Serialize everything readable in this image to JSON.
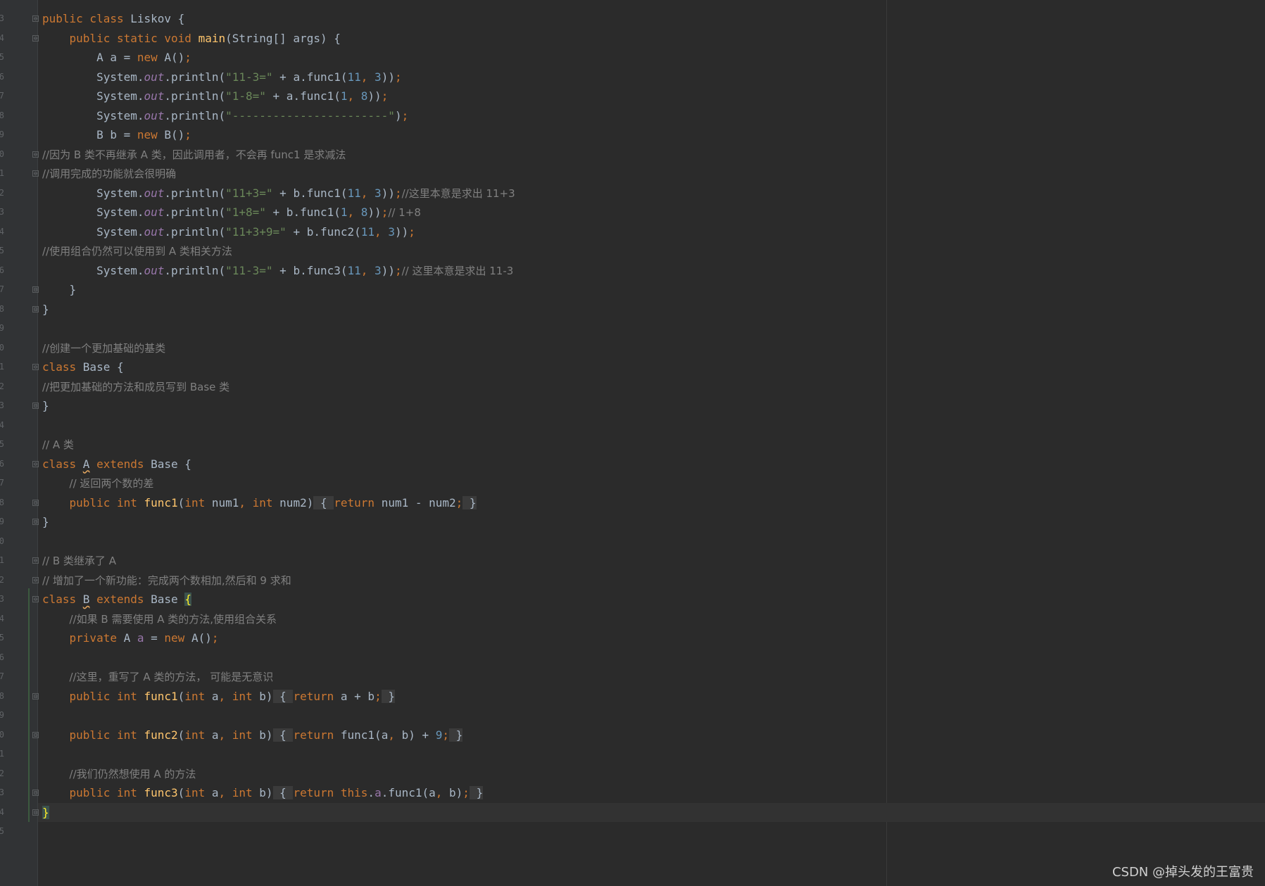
{
  "editor": {
    "line_numbers": [
      "3",
      "4",
      "5",
      "6",
      "7",
      "8",
      "9",
      "0",
      "1",
      "2",
      "3",
      "4",
      "5",
      "6",
      "7",
      "8",
      "9",
      "0",
      "1",
      "2",
      "3",
      "4",
      "5",
      "6",
      "7",
      "8",
      "9",
      "0",
      "1",
      "2",
      "3",
      "4",
      "5",
      "6",
      "7",
      "8",
      "9",
      "0",
      "1",
      "2",
      "3",
      "4",
      "5"
    ],
    "fold_markers": [
      "⊖",
      "⊖",
      "⊖",
      "⊖",
      "⊟",
      "⊟",
      "⊖",
      "⊟",
      "⊖",
      "⊟",
      "⊟",
      "⊖",
      "⊖",
      "⊖",
      "⊟",
      "⊟",
      "⊟",
      "⊟"
    ],
    "lines": [
      [
        [
          "kw",
          "public class "
        ],
        [
          "p",
          "Liskov {"
        ]
      ],
      [
        [
          "p",
          "    "
        ],
        [
          "kw",
          "public static void "
        ],
        [
          "fn",
          "main"
        ],
        [
          "p",
          "(String[] args) {"
        ]
      ],
      [
        [
          "p",
          "        A a = "
        ],
        [
          "kw",
          "new "
        ],
        [
          "p",
          "A()"
        ],
        [
          "kw",
          ";"
        ]
      ],
      [
        [
          "p",
          "        System."
        ],
        [
          "st",
          "out"
        ],
        [
          "p",
          ".println("
        ],
        [
          "str",
          "\"11-3=\""
        ],
        [
          "p",
          " + a.func1("
        ],
        [
          "num",
          "11"
        ],
        [
          "kw",
          ", "
        ],
        [
          "num",
          "3"
        ],
        [
          "p",
          "))"
        ],
        [
          "kw",
          ";"
        ]
      ],
      [
        [
          "p",
          "        System."
        ],
        [
          "st",
          "out"
        ],
        [
          "p",
          ".println("
        ],
        [
          "str",
          "\"1-8=\""
        ],
        [
          "p",
          " + a.func1("
        ],
        [
          "num",
          "1"
        ],
        [
          "kw",
          ", "
        ],
        [
          "num",
          "8"
        ],
        [
          "p",
          "))"
        ],
        [
          "kw",
          ";"
        ]
      ],
      [
        [
          "p",
          "        System."
        ],
        [
          "st",
          "out"
        ],
        [
          "p",
          ".println("
        ],
        [
          "str",
          "\"-----------------------\""
        ],
        [
          "p",
          ")"
        ],
        [
          "kw",
          ";"
        ]
      ],
      [
        [
          "p",
          "        B b = "
        ],
        [
          "kw",
          "new "
        ],
        [
          "p",
          "B()"
        ],
        [
          "kw",
          ";"
        ]
      ],
      [
        [
          "cm",
          "//因为 B 类不再继承 A 类，因此调用者，不会再 func1 是求减法"
        ]
      ],
      [
        [
          "cm",
          "//调用完成的功能就会很明确"
        ]
      ],
      [
        [
          "p",
          "        System."
        ],
        [
          "st",
          "out"
        ],
        [
          "p",
          ".println("
        ],
        [
          "str",
          "\"11+3=\""
        ],
        [
          "p",
          " + b.func1("
        ],
        [
          "num",
          "11"
        ],
        [
          "kw",
          ", "
        ],
        [
          "num",
          "3"
        ],
        [
          "p",
          "))"
        ],
        [
          "kw",
          ";"
        ],
        [
          "cm",
          "//这里本意是求出 11+3"
        ]
      ],
      [
        [
          "p",
          "        System."
        ],
        [
          "st",
          "out"
        ],
        [
          "p",
          ".println("
        ],
        [
          "str",
          "\"1+8=\""
        ],
        [
          "p",
          " + b.func1("
        ],
        [
          "num",
          "1"
        ],
        [
          "kw",
          ", "
        ],
        [
          "num",
          "8"
        ],
        [
          "p",
          "))"
        ],
        [
          "kw",
          ";"
        ],
        [
          "cm",
          "// 1+8"
        ]
      ],
      [
        [
          "p",
          "        System."
        ],
        [
          "st",
          "out"
        ],
        [
          "p",
          ".println("
        ],
        [
          "str",
          "\"11+3+9=\""
        ],
        [
          "p",
          " + b.func2("
        ],
        [
          "num",
          "11"
        ],
        [
          "kw",
          ", "
        ],
        [
          "num",
          "3"
        ],
        [
          "p",
          "))"
        ],
        [
          "kw",
          ";"
        ]
      ],
      [
        [
          "cm",
          "//使用组合仍然可以使用到 A 类相关方法"
        ]
      ],
      [
        [
          "p",
          "        System."
        ],
        [
          "st",
          "out"
        ],
        [
          "p",
          ".println("
        ],
        [
          "str",
          "\"11-3=\""
        ],
        [
          "p",
          " + b.func3("
        ],
        [
          "num",
          "11"
        ],
        [
          "kw",
          ", "
        ],
        [
          "num",
          "3"
        ],
        [
          "p",
          "))"
        ],
        [
          "kw",
          ";"
        ],
        [
          "cm",
          "// 这里本意是求出 11-3"
        ]
      ],
      [
        [
          "p",
          "    }"
        ]
      ],
      [
        [
          "p",
          "}"
        ]
      ],
      [],
      [
        [
          "cm",
          "//创建一个更加基础的基类"
        ]
      ],
      [
        [
          "kw",
          "class "
        ],
        [
          "p",
          "Base {"
        ]
      ],
      [
        [
          "cm",
          "//把更加基础的方法和成员写到 Base 类"
        ]
      ],
      [
        [
          "p",
          "}"
        ]
      ],
      [],
      [
        [
          "cm",
          "// A 类"
        ]
      ],
      [
        [
          "kw",
          "class "
        ],
        [
          "ul",
          "A"
        ],
        [
          "kw",
          " extends "
        ],
        [
          "p",
          "Base {"
        ]
      ],
      [
        [
          "p",
          "    "
        ],
        [
          "cm",
          "// 返回两个数的差"
        ]
      ],
      [
        [
          "p",
          "    "
        ],
        [
          "kw",
          "public int "
        ],
        [
          "fn",
          "func1"
        ],
        [
          "p",
          "("
        ],
        [
          "kw",
          "int "
        ],
        [
          "p",
          "num1"
        ],
        [
          "kw",
          ", int "
        ],
        [
          "p",
          "num2)"
        ],
        [
          "fb",
          " { "
        ],
        [
          "kw",
          "return "
        ],
        [
          "p",
          "num1 - num2"
        ],
        [
          "kw",
          ";"
        ],
        [
          "fb",
          " }"
        ]
      ],
      [
        [
          "p",
          "}"
        ]
      ],
      [],
      [
        [
          "cm",
          "// B 类继承了 A"
        ]
      ],
      [
        [
          "cm",
          "// 增加了一个新功能：完成两个数相加,然后和 9 求和"
        ]
      ],
      [
        [
          "kw",
          "class "
        ],
        [
          "ul",
          "B"
        ],
        [
          "kw",
          " extends "
        ],
        [
          "p",
          "Base "
        ],
        [
          "hb",
          "{"
        ]
      ],
      [
        [
          "p",
          "    "
        ],
        [
          "cm",
          "//如果 B 需要使用 A 类的方法,使用组合关系"
        ]
      ],
      [
        [
          "p",
          "    "
        ],
        [
          "kw",
          "private "
        ],
        [
          "p",
          "A "
        ],
        [
          "fld",
          "a"
        ],
        [
          "p",
          " = "
        ],
        [
          "kw",
          "new "
        ],
        [
          "p",
          "A()"
        ],
        [
          "kw",
          ";"
        ]
      ],
      [],
      [
        [
          "p",
          "    "
        ],
        [
          "cm",
          "//这里，重写了 A 类的方法， 可能是无意识"
        ]
      ],
      [
        [
          "p",
          "    "
        ],
        [
          "kw",
          "public int "
        ],
        [
          "fn",
          "func1"
        ],
        [
          "p",
          "("
        ],
        [
          "kw",
          "int "
        ],
        [
          "p",
          "a"
        ],
        [
          "kw",
          ", int "
        ],
        [
          "p",
          "b)"
        ],
        [
          "fb",
          " { "
        ],
        [
          "kw",
          "return "
        ],
        [
          "p",
          "a + b"
        ],
        [
          "kw",
          ";"
        ],
        [
          "fb",
          " }"
        ]
      ],
      [],
      [
        [
          "p",
          "    "
        ],
        [
          "kw",
          "public int "
        ],
        [
          "fn",
          "func2"
        ],
        [
          "p",
          "("
        ],
        [
          "kw",
          "int "
        ],
        [
          "p",
          "a"
        ],
        [
          "kw",
          ", int "
        ],
        [
          "p",
          "b)"
        ],
        [
          "fb",
          " { "
        ],
        [
          "kw",
          "return "
        ],
        [
          "p",
          "func1(a"
        ],
        [
          "kw",
          ", "
        ],
        [
          "p",
          "b) + "
        ],
        [
          "num",
          "9"
        ],
        [
          "kw",
          ";"
        ],
        [
          "fb",
          " }"
        ]
      ],
      [],
      [
        [
          "p",
          "    "
        ],
        [
          "cm",
          "//我们仍然想使用 A 的方法"
        ]
      ],
      [
        [
          "p",
          "    "
        ],
        [
          "kw",
          "public int "
        ],
        [
          "fn",
          "func3"
        ],
        [
          "p",
          "("
        ],
        [
          "kw",
          "int "
        ],
        [
          "p",
          "a"
        ],
        [
          "kw",
          ", int "
        ],
        [
          "p",
          "b)"
        ],
        [
          "fb",
          " { "
        ],
        [
          "kw",
          "return this"
        ],
        [
          "p",
          "."
        ],
        [
          "fld",
          "a"
        ],
        [
          "p",
          ".func1(a"
        ],
        [
          "kw",
          ", "
        ],
        [
          "p",
          "b)"
        ],
        [
          "kw",
          ";"
        ],
        [
          "fb",
          " }"
        ]
      ],
      [
        [
          "hb",
          "}"
        ]
      ]
    ]
  },
  "watermark": "CSDN @掉头发的王富贵"
}
